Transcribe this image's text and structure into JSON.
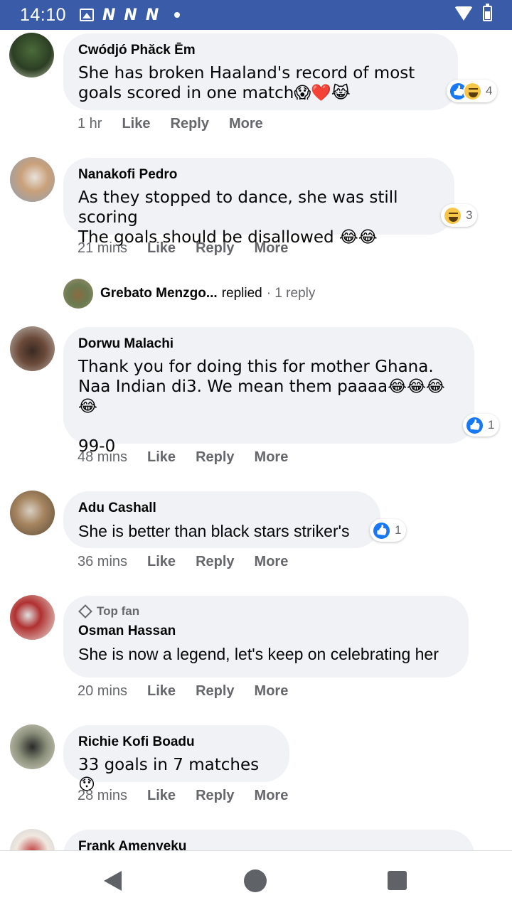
{
  "status_bar": {
    "time": "14:10",
    "notification_icons": [
      "N",
      "N",
      "N"
    ],
    "icons": [
      "gallery-icon",
      "wifi-icon",
      "battery-icon"
    ]
  },
  "comments": [
    {
      "author": "Cwódjó Phăck Ēm",
      "text": "She has broken Haaland's record of most goals scored in one match😱❤️😹",
      "reactions": [
        "like",
        "haha"
      ],
      "reaction_count": "4",
      "time": "1 hr",
      "actions": [
        "Like",
        "Reply",
        "More"
      ]
    },
    {
      "author": "Nanakofi Pedro",
      "text": "As they stopped to dance, she was still scoring\nThe goals should be disallowed 😂😂",
      "reactions": [
        "haha"
      ],
      "reaction_count": "3",
      "time": "21 mins",
      "actions": [
        "Like",
        "Reply",
        "More"
      ],
      "reply_summary": {
        "name": "Grebato Menzgo...",
        "verb": "replied",
        "count": "· 1 reply"
      }
    },
    {
      "author": "Dorwu Malachi",
      "text": "Thank you for doing this for mother Ghana. Naa Indian di3. We mean them paaaa😂😂😂😂\n\n99-0",
      "reactions": [
        "like"
      ],
      "reaction_count": "1",
      "time": "48 mins",
      "actions": [
        "Like",
        "Reply",
        "More"
      ]
    },
    {
      "author": "Adu Cashall",
      "text": "She is better than black stars striker's",
      "reactions": [
        "like"
      ],
      "reaction_count": "1",
      "time": "36 mins",
      "actions": [
        "Like",
        "Reply",
        "More"
      ]
    },
    {
      "badge": "Top fan",
      "author": "Osman Hassan",
      "text": "She is now a legend, let's keep on celebrating her",
      "time": "20 mins",
      "actions": [
        "Like",
        "Reply",
        "More"
      ]
    },
    {
      "author": "Richie Kofi Boadu",
      "text": "33 goals in 7 matches 😯",
      "time": "28 mins",
      "actions": [
        "Like",
        "Reply",
        "More"
      ]
    },
    {
      "author": "Frank Amenyeku"
    }
  ],
  "nav_bar": {
    "buttons": [
      "back-button",
      "home-button",
      "recents-button"
    ]
  },
  "colors": {
    "status_bar": "#3a5ca8",
    "bubble": "#f0f2f5",
    "secondary_text": "#65676b",
    "like_blue": "#1877f2",
    "haha_yellow": "#f7c74a"
  }
}
